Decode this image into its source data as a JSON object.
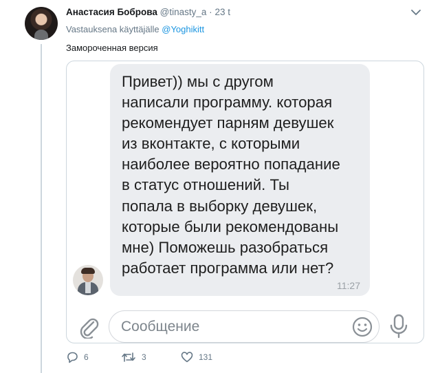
{
  "tweet": {
    "author_name": "Анастасия Боброва",
    "handle": "@tinasty_a",
    "separator": "·",
    "time": "23 t",
    "reply_prefix": "Vastauksena käyttäjälle",
    "reply_to": "@Yoghikitt",
    "text": "Замороченная версия"
  },
  "screenshot": {
    "message_lines": [
      "Привет)) мы с другом",
      "написали программу. которая",
      "рекомендует парням девушек",
      "из вконтакте, с которыми",
      "наиболее вероятно попадание",
      "в статус отношений. Ты",
      "попала в выборку девушек,",
      "которые были рекомендованы",
      "мне) Поможешь разобраться",
      "работает программа или нет?"
    ],
    "message_time": "11:27",
    "input_placeholder": "Сообщение"
  },
  "actions": {
    "reply_count": "6",
    "retweet_count": "3",
    "like_count": "131"
  },
  "icons": [
    "chevron-down-icon",
    "paperclip-icon",
    "emoji-icon",
    "microphone-icon",
    "reply-icon",
    "retweet-icon",
    "heart-icon"
  ],
  "colors": {
    "link": "#1b95e0",
    "secondary_text": "#657786",
    "bubble": "#ebedf0",
    "thread_line": "#ccd6dd"
  }
}
